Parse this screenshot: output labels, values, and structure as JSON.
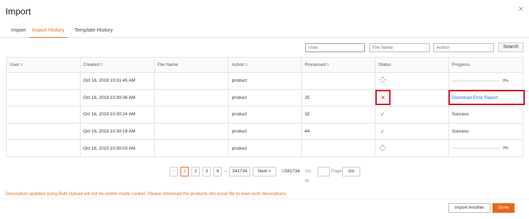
{
  "modal": {
    "title": "Import",
    "close_glyph": "×"
  },
  "tabs": [
    {
      "label": "Import",
      "active": false
    },
    {
      "label": "Import History",
      "active": true
    },
    {
      "label": "Template History",
      "active": false
    }
  ],
  "filters": {
    "user_placeholder": "User",
    "file_name_placeholder": "File Name",
    "action_placeholder": "Action",
    "search_label": "Search"
  },
  "table": {
    "headers": [
      {
        "label": "User",
        "sortable": true
      },
      {
        "label": "Created",
        "sortable": true
      },
      {
        "label": "File Name",
        "sortable": false
      },
      {
        "label": "Action",
        "sortable": true
      },
      {
        "label": "Processed",
        "sortable": true
      },
      {
        "label": "Status",
        "sortable": false
      },
      {
        "label": "Progress",
        "sortable": false
      }
    ],
    "rows": [
      {
        "user": "",
        "created": "Oct 16, 2019 10:31:45 AM",
        "file_name": "",
        "action": "product",
        "processed": "",
        "status": "in-progress",
        "progress_percent": "0%",
        "progress_value": 0
      },
      {
        "user": "",
        "created": "Oct 16, 2019 10:30:36 AM",
        "file_name": "",
        "action": "product",
        "processed": "25",
        "status": "failed",
        "progress_link": "Download Error Report"
      },
      {
        "user": "",
        "created": "Oct 16, 2019 10:30:24 AM",
        "file_name": "",
        "action": "product",
        "processed": "32",
        "status": "success",
        "progress_text": "Success"
      },
      {
        "user": "",
        "created": "Oct 16, 2019 10:30:19 AM",
        "file_name": "",
        "action": "product",
        "processed": "44",
        "status": "success",
        "progress_text": "Success"
      },
      {
        "user": "",
        "created": "Oct 16, 2019 10:30:03 AM",
        "file_name": "",
        "action": "product",
        "processed": "",
        "status": "in-progress",
        "progress_percent": "0%",
        "progress_value": 0
      }
    ]
  },
  "pagination": {
    "prev_glyph": "<",
    "pages": [
      "1",
      "2",
      "3",
      "4"
    ],
    "ellipsis": "...",
    "last_page": "341734",
    "next_label": "Next >",
    "current": "1",
    "total": "/341734",
    "goto_label": "Go to",
    "page_label": "Page",
    "go_label": "Go"
  },
  "notice": "Description updated using Bulk Upload will not be visible inside Loriket. Please download the products into excel file to view such descriptions",
  "footer": {
    "import_another_label": "Import Another",
    "done_label": "Done"
  },
  "colors": {
    "accent": "#e8671b",
    "error": "#e33333",
    "success": "#2aa845",
    "link": "#2a6bd4",
    "highlight": "#d8101f"
  },
  "icons": {
    "sort": "sort-icon",
    "in_progress": "spinner-icon",
    "failed": "x-icon",
    "success": "check-icon",
    "close": "close-icon"
  }
}
